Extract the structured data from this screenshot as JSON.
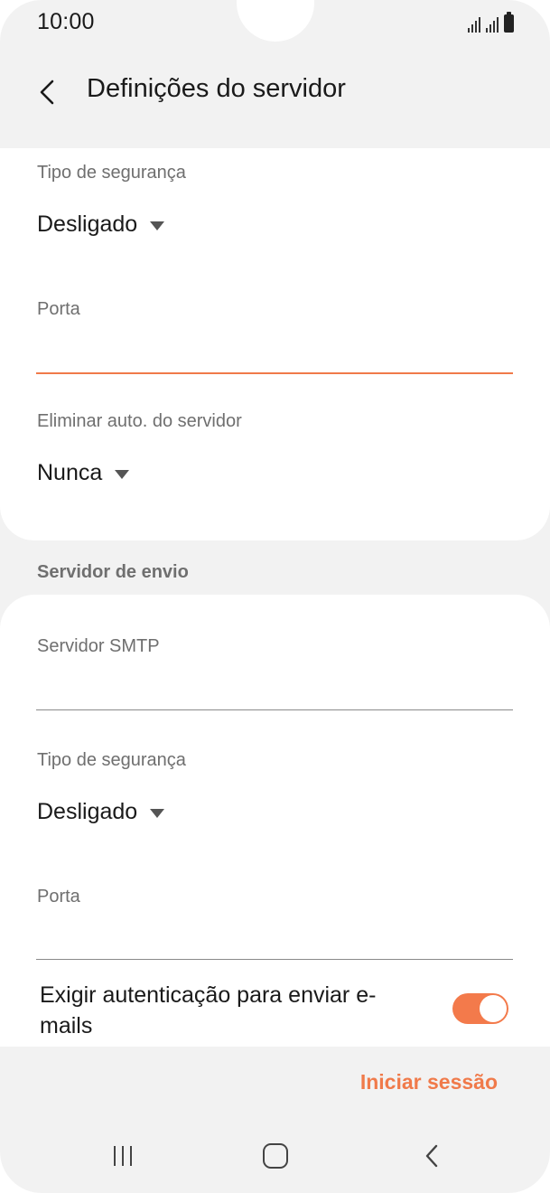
{
  "status_bar": {
    "time": "10:00"
  },
  "header": {
    "title": "Definições do servidor",
    "back_icon": "chevron-left-icon"
  },
  "incoming": {
    "security_label": "Tipo de segurança",
    "security_value": "Desligado",
    "port_label": "Porta",
    "port_value": "",
    "delete_label": "Eliminar auto. do servidor",
    "delete_value": "Nunca"
  },
  "outgoing": {
    "section_title": "Servidor de envio",
    "smtp_label": "Servidor SMTP",
    "smtp_value": "",
    "security_label": "Tipo de segurança",
    "security_value": "Desligado",
    "port_label": "Porta",
    "port_value": "",
    "auth_label": "Exigir autenticação para enviar e-mails",
    "auth_enabled": true
  },
  "actions": {
    "signin_label": "Iniciar sessão"
  },
  "colors": {
    "accent": "#f07a4a",
    "background": "#f2f2f2",
    "card": "#ffffff"
  },
  "nav_bar": {
    "icons": [
      "recent-apps-icon",
      "home-icon",
      "back-icon"
    ]
  }
}
